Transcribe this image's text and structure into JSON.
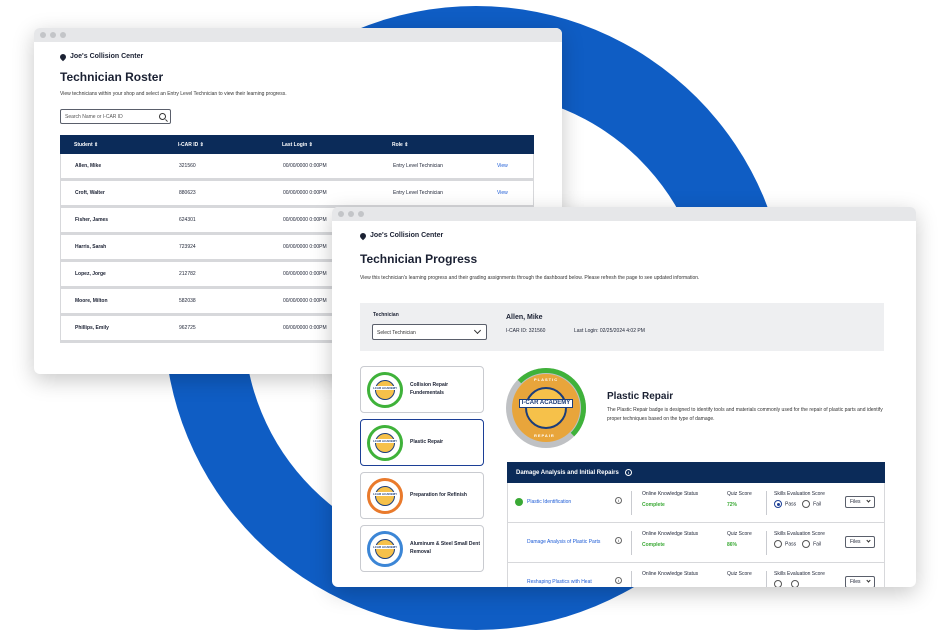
{
  "roster": {
    "location": "Joe's Collision Center",
    "title": "Technician Roster",
    "description": "View technicians within your shop and select an Entry Level Technician to view their learning progress.",
    "search_placeholder": "Search Name or I-CAR ID",
    "columns": [
      "Student",
      "I-CAR ID",
      "Last Login",
      "Role"
    ],
    "rows": [
      {
        "student": "Allen, Mike",
        "id": "321560",
        "last_login": "00/00/0000 0:00PM",
        "role": "Entry Level Technician",
        "action": "View"
      },
      {
        "student": "Croft, Walter",
        "id": "880623",
        "last_login": "00/00/0000 0:00PM",
        "role": "Entry Level Technician",
        "action": "View"
      },
      {
        "student": "Fisher, James",
        "id": "624301",
        "last_login": "00/00/0000 0:00PM",
        "role": "",
        "action": ""
      },
      {
        "student": "Harris, Sarah",
        "id": "723924",
        "last_login": "00/00/0000 0:00PM",
        "role": "",
        "action": ""
      },
      {
        "student": "Lopez, Jorge",
        "id": "212782",
        "last_login": "00/00/0000 0:00PM",
        "role": "",
        "action": ""
      },
      {
        "student": "Moore, Milton",
        "id": "582038",
        "last_login": "00/00/0000 0:00PM",
        "role": "",
        "action": ""
      },
      {
        "student": "Phillips, Emily",
        "id": "962725",
        "last_login": "00/00/0000 0:00PM",
        "role": "",
        "action": ""
      }
    ]
  },
  "progress": {
    "location": "Joe's Collision Center",
    "title": "Technician Progress",
    "description": "View this technician's learning progress and their grading assignments through the dashboard below. Please refresh the page to see updated information.",
    "technician_label": "Technician",
    "select_placeholder": "Select Technician",
    "tech_name": "Allen, Mike",
    "tech_id": "I-CAR ID: 321560",
    "last_login": "Last Login: 02/25/2024 4:02 PM",
    "badges": [
      {
        "name": "Collision Repair Fundementals",
        "ring": "#3fb23a"
      },
      {
        "name": "Plastic Repair",
        "ring": "#3fb23a"
      },
      {
        "name": "Preparation for Refinish",
        "ring": "#e97a2c"
      },
      {
        "name": "Aluminum & Steel Small Dent Removal",
        "ring": "#3c86d6"
      }
    ],
    "badge_icon_text": "I-CAR ACADEMY",
    "selected_badge": {
      "title": "Plastic Repair",
      "description": "The Plastic Repair badge is designed to identify tools and materials commonly used for the repair of plastic parts and identify proper techniques based on the type of damage.",
      "top_text": "PLASTIC",
      "bottom_text": "REPAIR",
      "center_text": "I-CAR ACADEMY"
    },
    "section_title": "Damage Analysis and Initial Repairs",
    "items": [
      {
        "name": "Plastic Identification",
        "complete_check": true,
        "knowledge_label": "Online Knowledge Status",
        "knowledge_status": "Complete",
        "quiz_label": "Quiz Score",
        "quiz_score": "72%",
        "skills_label": "Skills Evaluation Score",
        "pass_label": "Pass",
        "fail_label": "Fail",
        "pass_selected": true,
        "files_label": "Files"
      },
      {
        "name": "Damage Analysis of Plastic Parts",
        "complete_check": false,
        "knowledge_label": "Online Knowledge Status",
        "knowledge_status": "Complete",
        "quiz_label": "Quiz Score",
        "quiz_score": "86%",
        "skills_label": "Skills Evaluation Score",
        "pass_label": "Pass",
        "fail_label": "Fail",
        "pass_selected": false,
        "files_label": "Files"
      },
      {
        "name": "Reshaping Plastics with Heat",
        "complete_check": false,
        "knowledge_label": "Online Knowledge Status",
        "knowledge_status": "",
        "quiz_label": "Quiz Score",
        "quiz_score": "",
        "skills_label": "Skills Evaluation Score",
        "pass_label": "",
        "fail_label": "",
        "pass_selected": false,
        "files_label": "Files"
      }
    ]
  }
}
